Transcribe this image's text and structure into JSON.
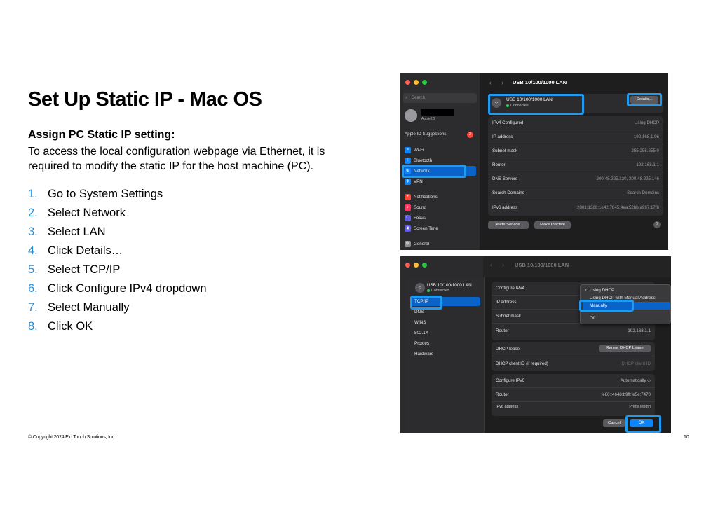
{
  "slide": {
    "title": "Set Up Static IP - Mac OS",
    "subheading": "Assign PC Static IP setting:",
    "intro": "To access the local configuration webpage via Ethernet, it is required to modify the static IP for the host machine (PC).",
    "steps": [
      {
        "num": "1.",
        "text": "Go to System Settings"
      },
      {
        "num": "2.",
        "text": "Select Network"
      },
      {
        "num": "3.",
        "text": "Select LAN"
      },
      {
        "num": "4.",
        "text": "Click Details…"
      },
      {
        "num": "5.",
        "text": "Select TCP/IP"
      },
      {
        "num": "6.",
        "text": "Click Configure IPv4 dropdown"
      },
      {
        "num": "7.",
        "text": "Select Manually"
      },
      {
        "num": "8.",
        "text": "Click OK"
      }
    ],
    "copyright": "© Copyright 2024 Elo Touch Solutions, Inc.",
    "page_number": "10"
  },
  "colors": {
    "step_number": "#2b8fd6",
    "highlight": "#1e9bf0",
    "selection": "#0a63c9"
  },
  "screenshot1": {
    "search_placeholder": "Search",
    "apple_id_label": "Apple ID",
    "suggestions_label": "Apple ID Suggestions",
    "suggestions_badge": "2",
    "sidebar": [
      {
        "label": "Wi-Fi",
        "icon": "wifi-icon",
        "color": "#0a84ff"
      },
      {
        "label": "Bluetooth",
        "icon": "bluetooth-icon",
        "color": "#0a84ff"
      },
      {
        "label": "Network",
        "icon": "globe-icon",
        "color": "#0a84ff"
      },
      {
        "label": "VPN",
        "icon": "vpn-icon",
        "color": "#0a84ff"
      },
      {
        "label": "Notifications",
        "icon": "bell-icon",
        "color": "#ff453a"
      },
      {
        "label": "Sound",
        "icon": "speaker-icon",
        "color": "#ff375f"
      },
      {
        "label": "Focus",
        "icon": "moon-icon",
        "color": "#5e5ce6"
      },
      {
        "label": "Screen Time",
        "icon": "hourglass-icon",
        "color": "#5e5ce6"
      },
      {
        "label": "General",
        "icon": "gear-icon",
        "color": "#8e8e93"
      }
    ],
    "header": "USB 10/100/1000 LAN",
    "interface_name": "USB 10/100/1000 LAN",
    "interface_status": "Connected",
    "details_button": "Details...",
    "rows": [
      {
        "label": "IPv4 Configured",
        "value": "Using DHCP"
      },
      {
        "label": "IP address",
        "value": "192.168.1.96"
      },
      {
        "label": "Subnet mask",
        "value": "255.255.255.0"
      },
      {
        "label": "Router",
        "value": "192.168.1.1"
      },
      {
        "label": "DNS Servers",
        "value": "200.48.225.130, 200.48.225.146"
      },
      {
        "label": "Search Domains",
        "value": "Search Domains"
      },
      {
        "label": "IPv6 address",
        "value": "2001:1388:1e42:7845:4ea:52bb:a997:17f8"
      }
    ],
    "delete_button": "Delete Service...",
    "inactive_button": "Make Inactive",
    "help_label": "?"
  },
  "screenshot2": {
    "header": "USB 10/100/1000 LAN",
    "interface_name": "USB 10/100/1000 LAN",
    "interface_status": "Connected",
    "tabs": [
      "TCP/IP",
      "DNS",
      "WINS",
      "802.1X",
      "Proxies",
      "Hardware"
    ],
    "rows": [
      {
        "label": "Configure IPv4",
        "value": ""
      },
      {
        "label": "IP address",
        "value": ""
      },
      {
        "label": "Subnet mask",
        "value": ""
      },
      {
        "label": "Router",
        "value": "192.168.1.1"
      }
    ],
    "dropdown_options": [
      {
        "label": "Using DHCP",
        "checked": true
      },
      {
        "label": "Using DHCP with Manual Address",
        "checked": false
      },
      {
        "label": "Manually",
        "checked": false
      },
      {
        "label": "Off",
        "checked": false
      }
    ],
    "dhcp_lease_label": "DHCP lease",
    "renew_button": "Renew DHCP Lease",
    "client_id_label": "DHCP client ID (if required)",
    "client_id_placeholder": "DHCP client ID",
    "configure_ipv6_label": "Configure IPv6",
    "configure_ipv6_value": "Automatically ◇",
    "router6_label": "Router",
    "router6_value": "fe80::4648:b9ff:fe5e:7470",
    "ipv6_address_label": "IPv6 address",
    "prefix_label": "Prefix length",
    "cancel_button": "Cancel",
    "ok_button": "OK"
  }
}
